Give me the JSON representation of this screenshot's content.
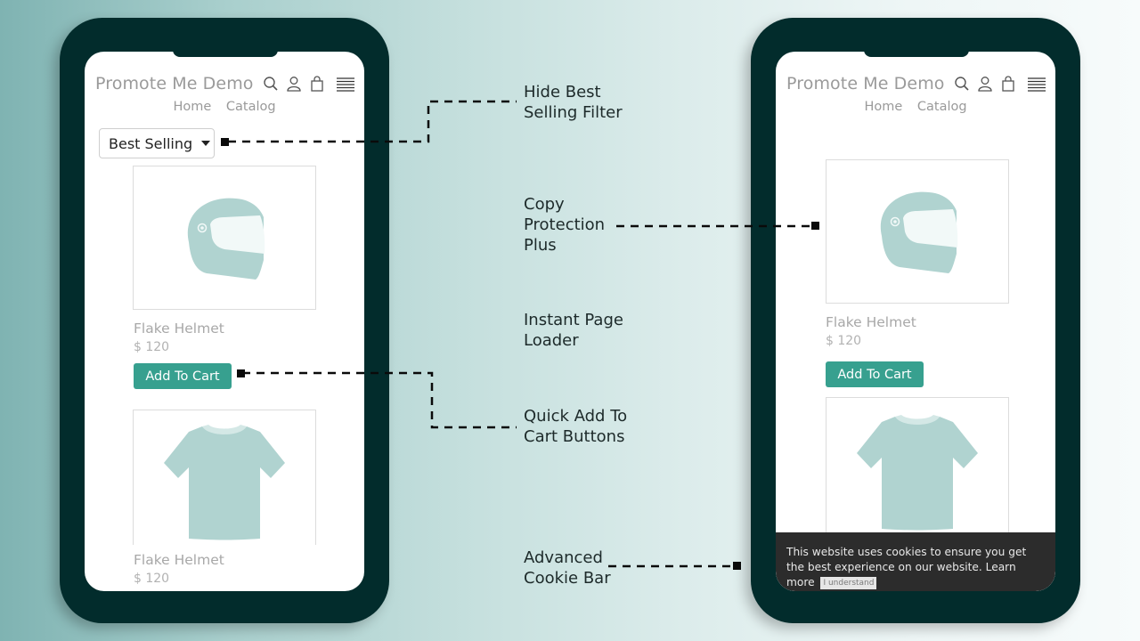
{
  "phones": {
    "left": {
      "store_title": "Promote Me Demo",
      "nav": [
        "Home",
        "Catalog"
      ],
      "sort_select": {
        "value": "Best Selling"
      },
      "products": [
        {
          "name": "Flake Helmet",
          "price": "$ 120",
          "button": "Add To Cart",
          "image": "helmet-image"
        },
        {
          "name": "Flake Helmet",
          "price": "$ 120",
          "image": "tshirt-image"
        }
      ]
    },
    "right": {
      "store_title": "Promote Me Demo",
      "nav": [
        "Home",
        "Catalog"
      ],
      "products": [
        {
          "name": "Flake Helmet",
          "price": "$ 120",
          "button": "Add To Cart",
          "image": "helmet-image"
        },
        {
          "image": "tshirt-image"
        }
      ],
      "cookie_bar": {
        "message": "This website uses cookies to ensure you get the best experience on our website.",
        "learn_more": "Learn more",
        "accept": "I understand"
      }
    }
  },
  "icons": [
    "search-icon",
    "user-icon",
    "shopping-bag-icon",
    "hamburger-menu-icon"
  ],
  "features": [
    {
      "line1": "Hide Best",
      "line2": "Selling Filter"
    },
    {
      "line1": "Copy",
      "line2": "Protection",
      "line3": "Plus"
    },
    {
      "line1": "Instant Page",
      "line2": "Loader"
    },
    {
      "line1": "Quick Add To",
      "line2": "Cart Buttons"
    },
    {
      "line1": "Advanced",
      "line2": "Cookie Bar"
    }
  ],
  "colors": {
    "phone_frame": "#022c2c",
    "accent_button": "#37a08f",
    "product_art": "#b0d3d0",
    "cookie_bar": "#2c2c2c"
  }
}
